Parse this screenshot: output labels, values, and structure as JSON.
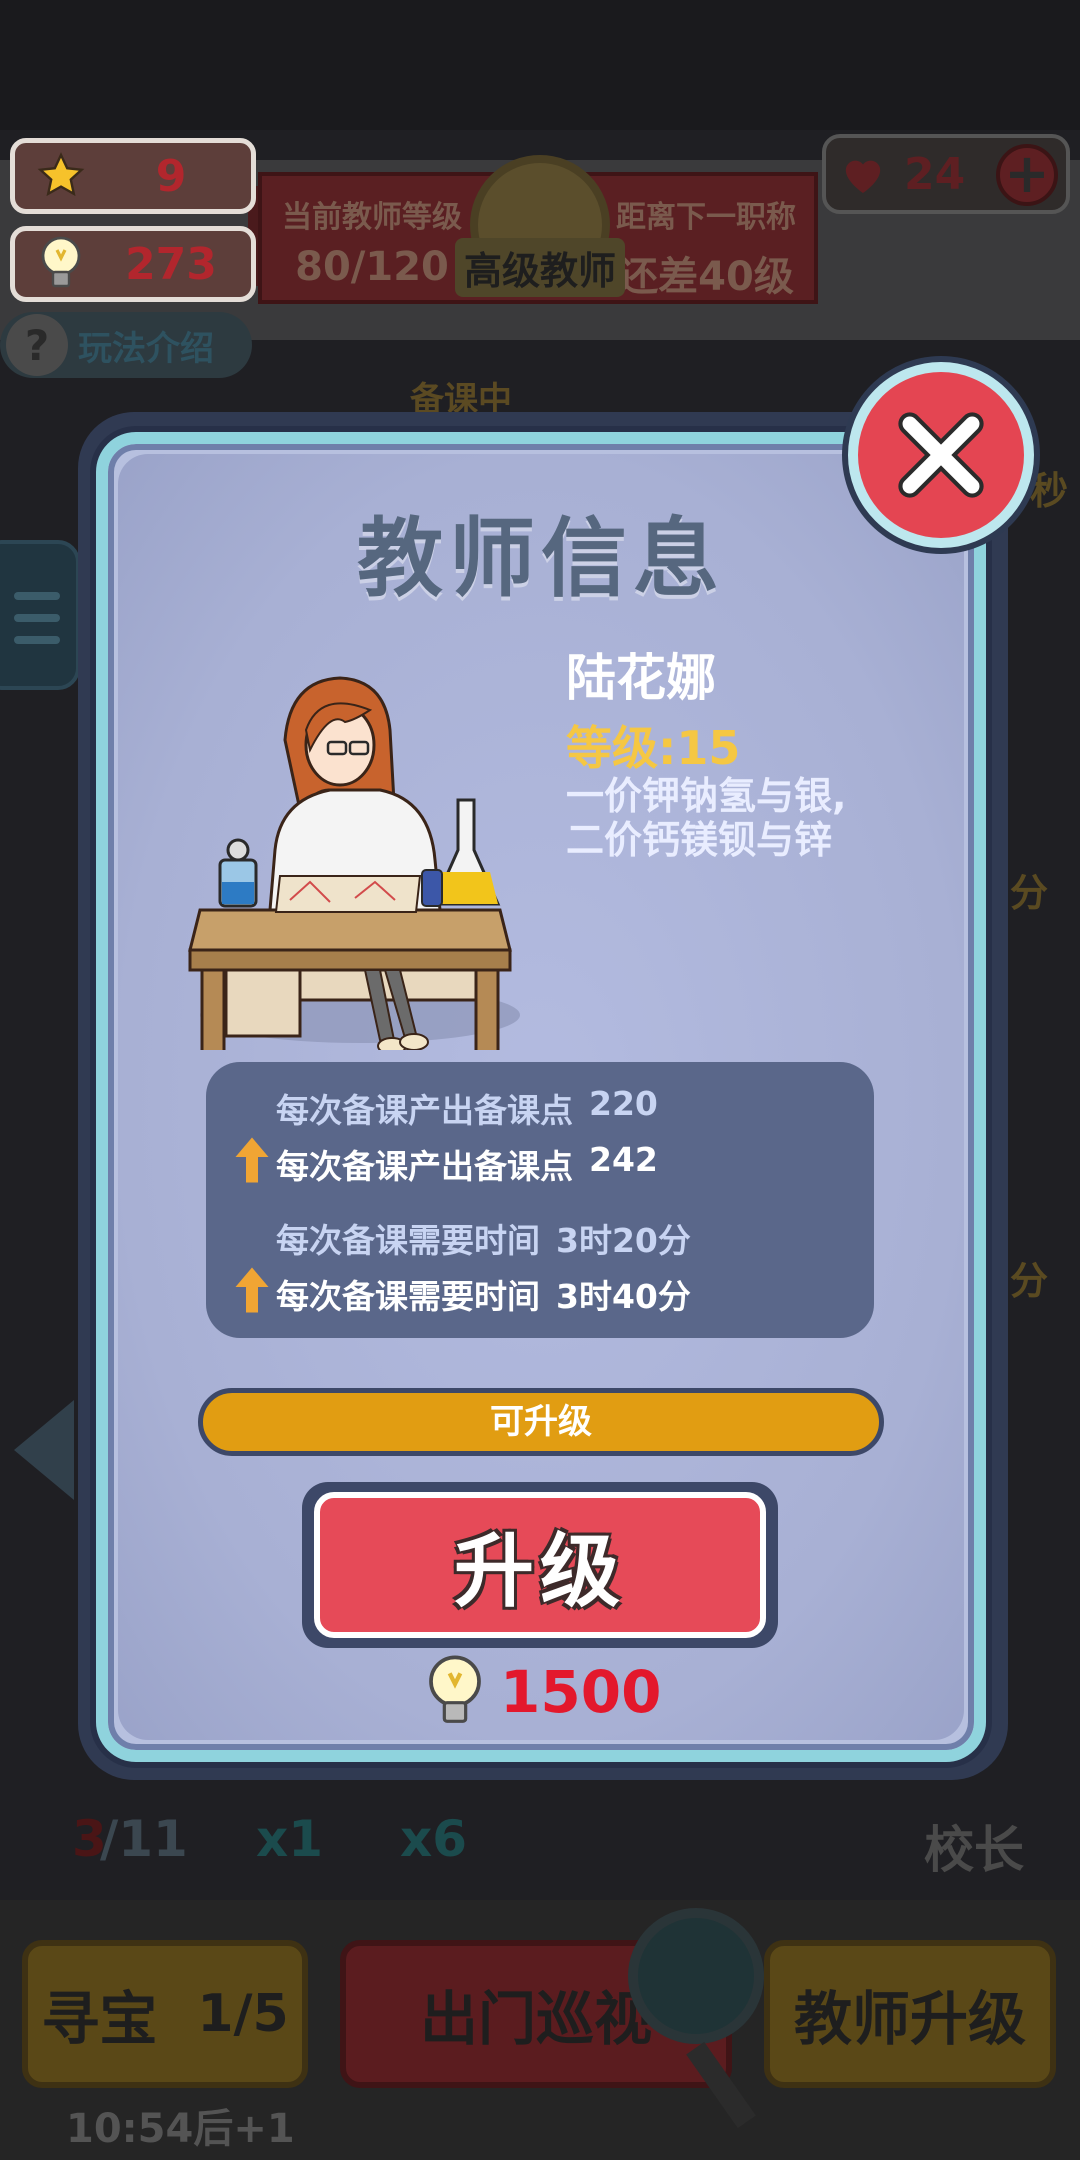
{
  "hud": {
    "stars": "9",
    "ideas": "273",
    "lives": "24",
    "lives_add": "+",
    "help_label": "玩法介绍"
  },
  "banner": {
    "current_level_label": "当前教师等级",
    "current_level_value": "80/120",
    "rank_title": "高级教师",
    "next_rank_label": "距离下一职称",
    "next_rank_value": "还差40级"
  },
  "background": {
    "preparing_text": "备课中",
    "side_suffix_1": "秒",
    "side_suffix_2": "分",
    "side_suffix_3": "分",
    "count_current": "3",
    "count_total": "/11",
    "item_1": "x1",
    "item_2": "x6",
    "principal_label": "校长",
    "treasure_label": "寻宝",
    "treasure_count": "1/5",
    "patrol_label": "出门巡视",
    "teacher_upgrade_label": "教师升级",
    "timer": "10:54后+1"
  },
  "modal": {
    "title": "教师信息",
    "teacher_name": "陆花娜",
    "level_text": "等级:15",
    "motto_line1": "一价钾钠氢与银,",
    "motto_line2": "二价钙镁钡与锌",
    "stats": [
      {
        "label": "每次备课产出备课点",
        "value": "220"
      },
      {
        "label": "每次备课产出备课点",
        "value": "242"
      },
      {
        "label": "每次备课需要时间",
        "value": "3时20分"
      },
      {
        "label": "每次备课需要时间",
        "value": "3时40分"
      }
    ],
    "status_bar_text": "可升级",
    "upgrade_label": "升级",
    "upgrade_cost": "1500"
  },
  "colors": {
    "close_red": "#e44552",
    "upgrade_red": "#e64a58",
    "level_gold": "#f5c743",
    "status_orange": "#e19d12",
    "cost_red": "#e3182c"
  },
  "icons": [
    "star-icon",
    "lightbulb-icon",
    "heart-icon",
    "plus-icon",
    "question-icon",
    "close-icon",
    "up-arrow-icon",
    "menu-icon"
  ]
}
